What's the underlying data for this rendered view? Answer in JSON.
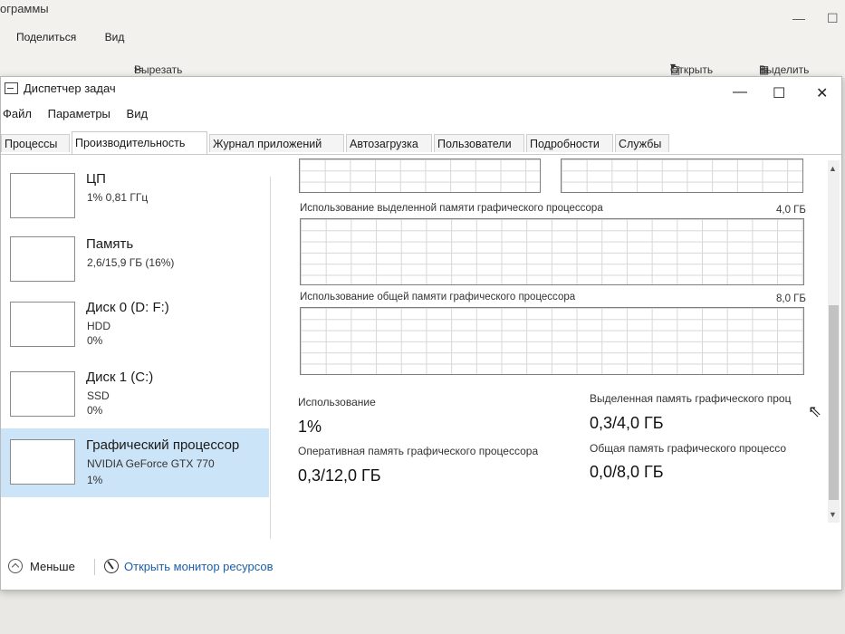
{
  "background_window": {
    "title": "ограммы",
    "menu": [
      "Поделиться",
      "Вид"
    ],
    "toolbar": {
      "cut": "Вырезать",
      "open": "Открыть",
      "select_all": "Выделить все"
    }
  },
  "window": {
    "title": "Диспетчер задач",
    "minimize": "—",
    "maximize": "☐",
    "close": "✕"
  },
  "menu": [
    "Файл",
    "Параметры",
    "Вид"
  ],
  "tabs": [
    "Процессы",
    "Производительность",
    "Журнал приложений",
    "Автозагрузка",
    "Пользователи",
    "Подробности",
    "Службы"
  ],
  "active_tab": "Производительность",
  "sidebar": {
    "items": [
      {
        "title": "ЦП",
        "line1": "1% 0,81 ГГц",
        "line2": ""
      },
      {
        "title": "Память",
        "line1": "2,6/15,9 ГБ (16%)",
        "line2": ""
      },
      {
        "title": "Диск 0 (D: F:)",
        "line1": "HDD",
        "line2": "0%"
      },
      {
        "title": "Диск 1 (C:)",
        "line1": "SSD",
        "line2": "0%"
      },
      {
        "title": "Графический процессор",
        "line1": "NVIDIA GeForce GTX 770",
        "line2": "1%"
      }
    ]
  },
  "graphs": {
    "dedicated": {
      "label": "Использование выделенной памяти графического процессора",
      "max": "4,0 ГБ"
    },
    "shared": {
      "label": "Использование общей памяти графического процессора",
      "max": "8,0 ГБ"
    }
  },
  "stats": {
    "usage_label": "Использование",
    "usage_value": "1%",
    "dedicated_label": "Выделенная память графического проц",
    "dedicated_value": "0,3/4,0 ГБ",
    "gpu_ram_label": "Оперативная память графического процессора",
    "gpu_ram_value": "0,3/12,0 ГБ",
    "shared_label": "Общая память графического процессо",
    "shared_value": "0,0/8,0 ГБ"
  },
  "footer": {
    "less": "Меньше",
    "resource_monitor": "Открыть монитор ресурсов"
  }
}
